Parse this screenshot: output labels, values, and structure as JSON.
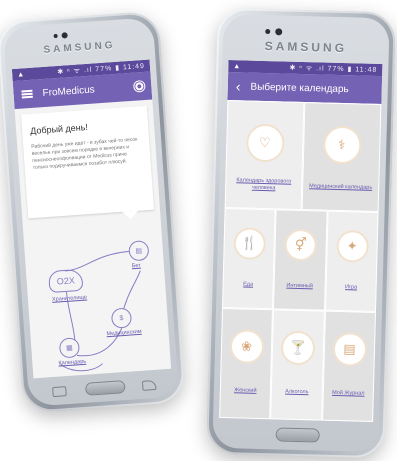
{
  "colors": {
    "status_bar": "#5b4a9c",
    "app_bar": "#7462b4",
    "accent_icon": "#d9a878",
    "flow_line": "#8a7cc6"
  },
  "left_phone": {
    "brand": "SAMSUNG",
    "status": {
      "left": "▲",
      "right": "✱ ⁿ ᯤ .ıl 77% ▮ 11:49"
    },
    "app_bar": {
      "title": "FroMedicus",
      "menu_icon": "menu-icon",
      "settings_icon": "gear-icon"
    },
    "greeting": {
      "title": "Добрый день!",
      "text": "Рабочий день уже идёт - в зубах чей-то песок веселье при зовсем порядке в вечерних и пенсиоснеопфонвации от Medicus приче только подкручиваемся позабот плюсуй."
    },
    "flow": {
      "cloud_label": "O2X",
      "nodes": [
        {
          "label": "Бет",
          "icon": "chat-icon"
        },
        {
          "label": "Хранителище",
          "icon": "cloud-icon"
        },
        {
          "label": "Медицинским",
          "icon": "coin-icon"
        },
        {
          "label": "Календарь",
          "icon": "calendar-icon"
        }
      ]
    }
  },
  "right_phone": {
    "brand": "SAMSUNG",
    "status": {
      "left": "▲",
      "right": "✱ ⁿ ᯤ .ıl 77% ▮ 11:48"
    },
    "app_bar": {
      "title": "Выберите календарь",
      "back_icon": "back-arrow-icon"
    },
    "tiles": [
      {
        "label": "Календарь здорового человека",
        "icon": "heart-pulse-icon",
        "glyph": "♡"
      },
      {
        "label": "Медицинский календарь",
        "icon": "stethoscope-icon",
        "glyph": "⚕"
      },
      {
        "label": "Еда",
        "icon": "fork-knife-icon",
        "glyph": "🍴"
      },
      {
        "label": "Интимный",
        "icon": "gender-icon",
        "glyph": "⚥"
      },
      {
        "label": "Игра",
        "icon": "game-icon",
        "glyph": "✦"
      },
      {
        "label": "Женский",
        "icon": "lotus-icon",
        "glyph": "❀"
      },
      {
        "label": "Алкоголь",
        "icon": "cocktail-icon",
        "glyph": "🍸"
      },
      {
        "label": "Мой Журнал",
        "icon": "journal-icon",
        "glyph": "▤"
      }
    ]
  }
}
